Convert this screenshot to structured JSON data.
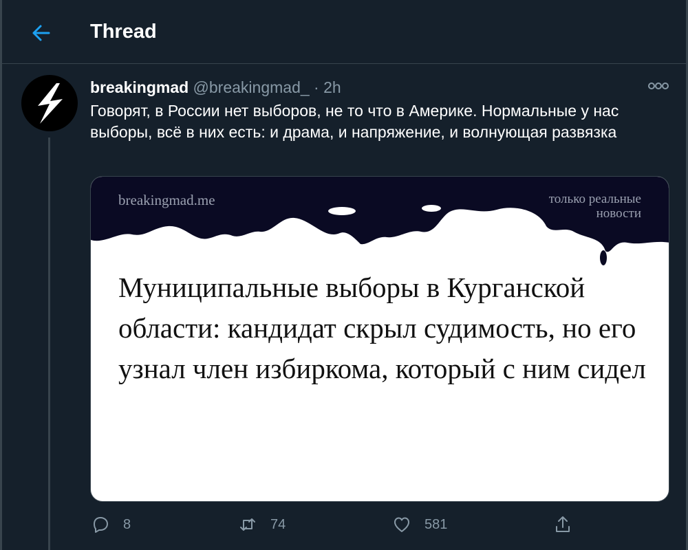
{
  "header": {
    "title": "Thread"
  },
  "tweet": {
    "author_name": "breakingmad",
    "author_handle": "@breakingmad_",
    "separator": "·",
    "time": "2h",
    "text": "Говорят, в России нет выборов, не то что в Америке. Нормальные у нас выборы, всё в них есть: и драма, и напряжение, и волнующая развязка",
    "card": {
      "site": "breakingmad.me",
      "tagline_line1": "только реальные",
      "tagline_line2": "новости",
      "headline": "Муниципальные выборы в Курганской области: кандидат скрыл судимость, но его узнал член избиркома, который с ним сидел"
    },
    "stats": {
      "replies": "8",
      "retweets": "74",
      "likes": "581"
    }
  },
  "colors": {
    "background": "#15202b",
    "accent": "#1da1f2",
    "muted": "#8899a6",
    "border": "#38444d",
    "card_header": "#0a0a23"
  },
  "icons": [
    "back-arrow-icon",
    "lightning-icon",
    "more-icon",
    "reply-icon",
    "retweet-icon",
    "like-icon",
    "share-icon"
  ]
}
